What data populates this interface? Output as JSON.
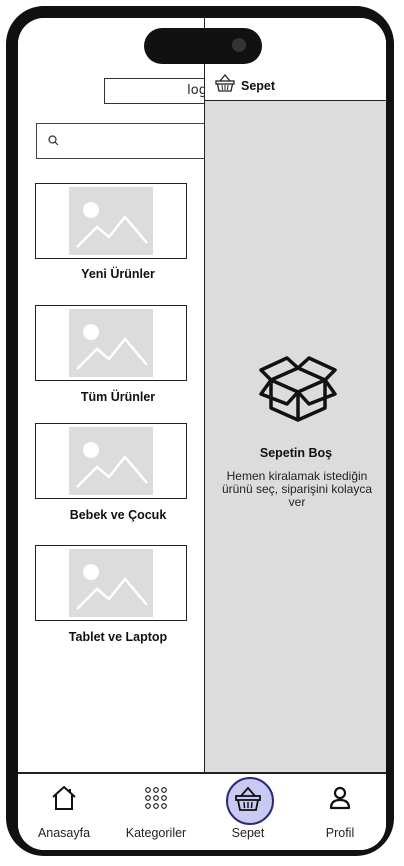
{
  "header": {
    "login_text": "log"
  },
  "search": {
    "placeholder": ""
  },
  "categories": [
    {
      "label": "Yeni Ürünler"
    },
    {
      "label": "Tüm Ürünler"
    },
    {
      "label": "Bebek ve Çocuk"
    },
    {
      "label": "Tablet ve Laptop"
    }
  ],
  "cart": {
    "title": "Sepet",
    "empty_title": "Sepetin Boş",
    "empty_message": "Hemen kiralamak istediğin ürünü seç, siparişini kolayca ver"
  },
  "bottom_nav": {
    "items": [
      {
        "label": "Anasayfa",
        "icon": "home-icon"
      },
      {
        "label": "Kategoriler",
        "icon": "grid-icon"
      },
      {
        "label": "Sepet",
        "icon": "basket-icon",
        "active": true
      },
      {
        "label": "Profil",
        "icon": "user-icon"
      }
    ]
  },
  "colors": {
    "active_nav_bg": "#c9c9f2",
    "active_nav_border": "#2a2a7a",
    "panel_bg": "#dcdcdc"
  }
}
